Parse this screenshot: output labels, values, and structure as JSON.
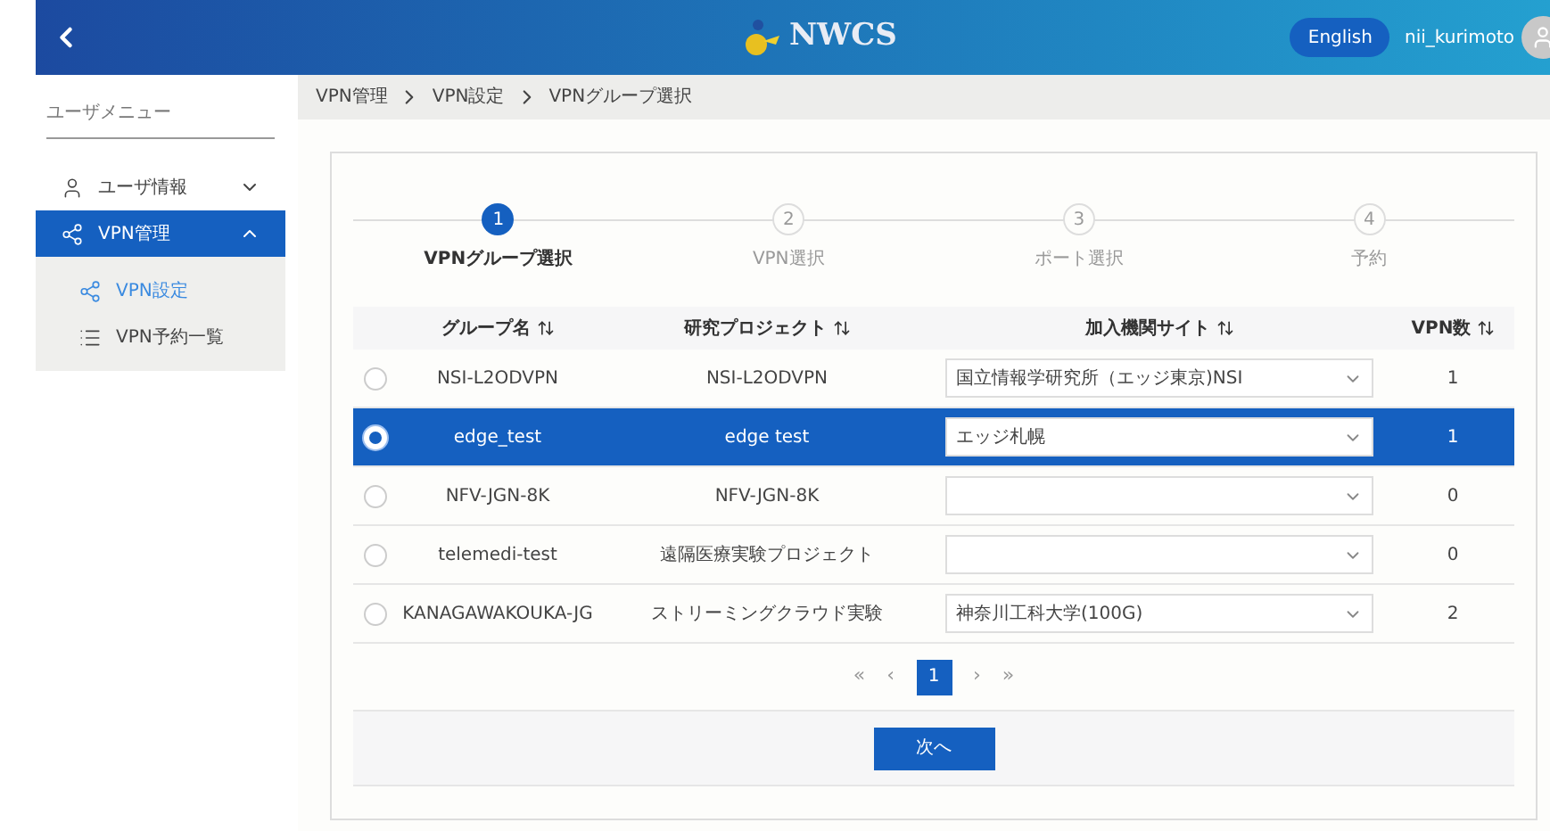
{
  "header": {
    "logo_text": "NWCS",
    "language_button": "English",
    "username": "nii_kurimoto"
  },
  "sidebar": {
    "title": "ユーザメニュー",
    "items": [
      {
        "label": "ユーザ情報",
        "kind": "user",
        "expanded": false,
        "selected": false
      },
      {
        "label": "VPN管理",
        "kind": "share",
        "expanded": true,
        "selected": true,
        "children": [
          {
            "label": "VPN設定",
            "kind": "share",
            "selected": true
          },
          {
            "label": "VPN予約一覧",
            "kind": "list",
            "selected": false
          }
        ]
      }
    ]
  },
  "breadcrumb": [
    "VPN管理",
    "VPN設定",
    "VPNグループ選択"
  ],
  "stepper": [
    {
      "number": "1",
      "label": "VPNグループ選択",
      "selected": true
    },
    {
      "number": "2",
      "label": "VPN選択",
      "selected": false
    },
    {
      "number": "3",
      "label": "ポート選択",
      "selected": false
    },
    {
      "number": "4",
      "label": "予約",
      "selected": false
    }
  ],
  "table": {
    "columns": [
      "グループ名",
      "研究プロジェクト",
      "加入機関サイト",
      "VPN数"
    ],
    "rows": [
      {
        "selected": false,
        "group": "NSI-L2ODVPN",
        "project": "NSI-L2ODVPN",
        "site": "国立情報学研究所（エッジ東京)NSI",
        "vpn_count": "1"
      },
      {
        "selected": true,
        "group": "edge_test",
        "project": "edge test",
        "site": "エッジ札幌",
        "vpn_count": "1"
      },
      {
        "selected": false,
        "group": "NFV-JGN-8K",
        "project": "NFV-JGN-8K",
        "vpn_count": "0"
      },
      {
        "selected": false,
        "group": "telemedi-test",
        "project": "遠隔医療実験プロジェクト",
        "vpn_count": "0"
      },
      {
        "selected": false,
        "group": "KANAGAWAKOUKA-JG",
        "project": "ストリーミングクラウド実験",
        "site": "神奈川工科大学(100G)",
        "vpn_count": "2"
      }
    ]
  },
  "pagination": {
    "first": "«",
    "prev": "‹",
    "pages": [
      {
        "label": "1",
        "selected": true
      }
    ],
    "next": "›",
    "last": "»"
  },
  "next_button": "次へ"
}
